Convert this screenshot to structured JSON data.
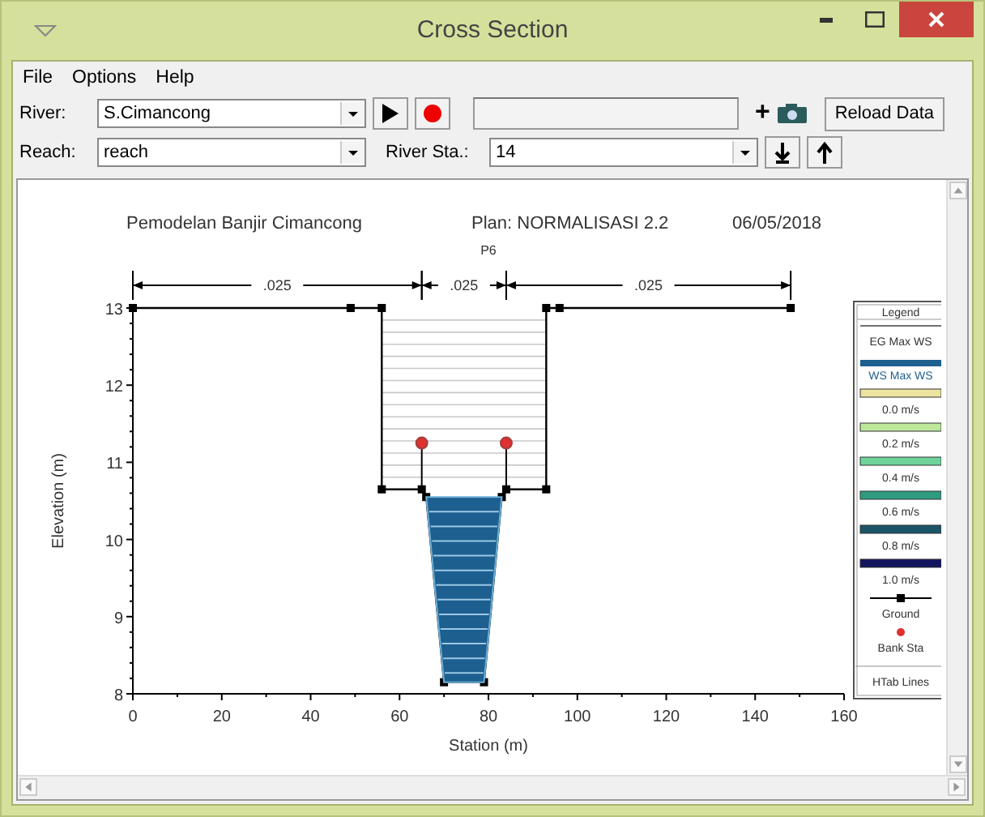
{
  "window": {
    "title": "Cross Section"
  },
  "menu": [
    "File",
    "Options",
    "Help"
  ],
  "toolbar": {
    "river": {
      "label": "River:",
      "value": "S.Cimancong"
    },
    "reach": {
      "label": "Reach:",
      "value": "reach"
    },
    "river_sta": {
      "label": "River Sta.:",
      "value": "14"
    },
    "plus": "+",
    "reload_button": "Reload Data"
  },
  "plot": {
    "title": "Pemodelan Banjir Cimancong",
    "plan": "Plan: NORMALISASI 2.2",
    "date": "06/05/2018",
    "section_label": "P6",
    "n_values": [
      ".025",
      ".025",
      ".025"
    ],
    "chart_data": {
      "type": "line",
      "xlabel": "Station (m)",
      "ylabel": "Elevation (m)",
      "x": [
        0,
        49,
        56,
        56,
        65,
        66,
        70,
        79,
        83,
        84,
        93,
        93,
        96,
        148
      ],
      "series": [
        {
          "name": "Ground",
          "type": "line",
          "color": "#000000",
          "marker": "square",
          "values": [
            13,
            13,
            13,
            10.65,
            10.65,
            10.55,
            8.15,
            8.15,
            10.55,
            10.65,
            10.65,
            13,
            13,
            13
          ]
        },
        {
          "name": "WS Max WS",
          "type": "area",
          "color": "#1d5f8f",
          "values": [
            null,
            null,
            null,
            null,
            null,
            10.55,
            10.55,
            10.55,
            10.55,
            null,
            null,
            null,
            null,
            null
          ]
        },
        {
          "name": "Bank Sta",
          "type": "scatter",
          "color": "#e03030",
          "values": [
            null,
            null,
            null,
            null,
            11.25,
            null,
            null,
            null,
            null,
            11.25,
            null,
            null,
            null,
            null
          ]
        }
      ],
      "xlim": [
        0,
        160
      ],
      "ylim": [
        8,
        13
      ],
      "xticks": [
        0,
        20,
        40,
        60,
        80,
        100,
        120,
        140,
        160
      ],
      "yticks": [
        8,
        9,
        10,
        11,
        12,
        13
      ],
      "legend": "right"
    },
    "legend": {
      "title": "Legend",
      "first": "EG Max WS",
      "items": [
        {
          "label": "0.0 m/s",
          "color": "#ece4a0"
        },
        {
          "label": "0.2 m/s",
          "color": "#bde89a"
        },
        {
          "label": "0.4 m/s",
          "color": "#6fd49a"
        },
        {
          "label": "0.6 m/s",
          "color": "#2f9c82"
        },
        {
          "label": "0.8 m/s",
          "color": "#1b5668"
        },
        {
          "label": "1.0 m/s",
          "color": "#111560"
        }
      ],
      "footer": "HTab Lines"
    }
  }
}
